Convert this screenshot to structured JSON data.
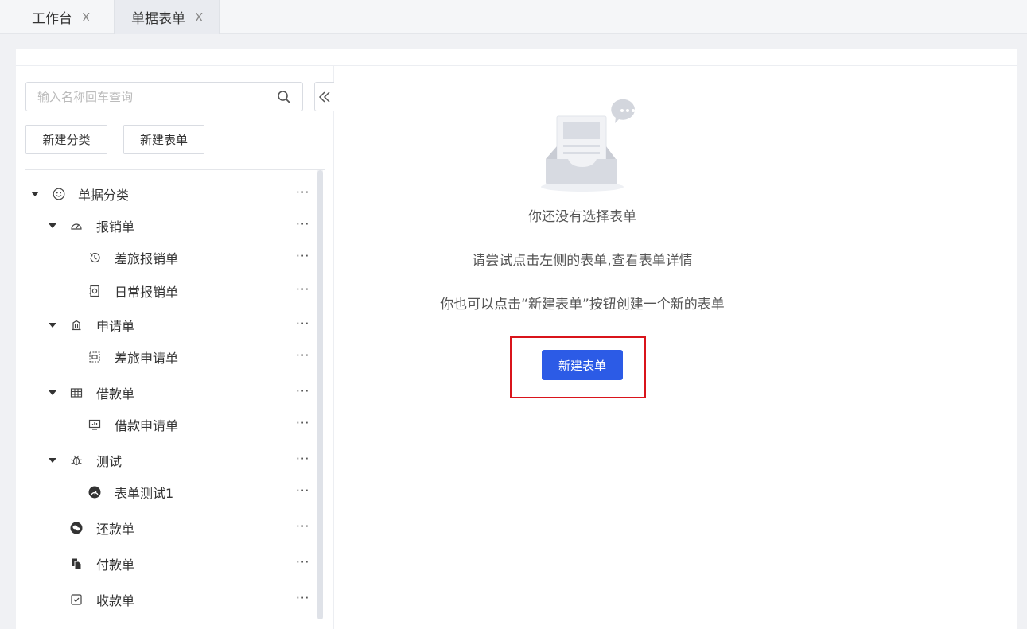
{
  "tabs": [
    {
      "label": "工作台",
      "close": "X",
      "active": false
    },
    {
      "label": "单据表单",
      "close": "X",
      "active": true
    }
  ],
  "sidebar": {
    "search_placeholder": "输入名称回车查询",
    "new_category_label": "新建分类",
    "new_form_label": "新建表单",
    "more_glyph": "···",
    "tree": [
      {
        "label": "单据分类",
        "level": 0,
        "expanded": true,
        "icon": "smiley-icon"
      },
      {
        "label": "报销单",
        "level": 1,
        "expanded": true,
        "icon": "dashboard-icon"
      },
      {
        "label": "差旅报销单",
        "level": 2,
        "icon": "history-icon"
      },
      {
        "label": "日常报销单",
        "level": 2,
        "icon": "safe-icon"
      },
      {
        "label": "申请单",
        "level": 1,
        "expanded": true,
        "icon": "bank-icon"
      },
      {
        "label": "差旅申请单",
        "level": 2,
        "icon": "scan-icon"
      },
      {
        "label": "借款单",
        "level": 1,
        "expanded": true,
        "icon": "table-icon"
      },
      {
        "label": "借款申请单",
        "level": 2,
        "icon": "monitor-chart-icon"
      },
      {
        "label": "测试",
        "level": 1,
        "expanded": true,
        "icon": "bug-icon"
      },
      {
        "label": "表单测试1",
        "level": 2,
        "icon": "dashboard-filled-icon"
      },
      {
        "label": "还款单",
        "level": 1,
        "icon": "wechat-icon"
      },
      {
        "label": "付款单",
        "level": 1,
        "icon": "copy-icon"
      },
      {
        "label": "收款单",
        "level": 1,
        "icon": "checkbox-icon"
      }
    ]
  },
  "empty_state": {
    "title": "你还没有选择表单",
    "hint1": "请尝试点击左侧的表单,查看表单详情",
    "hint2": "你也可以点击“新建表单”按钮创建一个新的表单",
    "button_label": "新建表单"
  },
  "colors": {
    "primary": "#2c5be6",
    "highlight": "#d9141b"
  }
}
